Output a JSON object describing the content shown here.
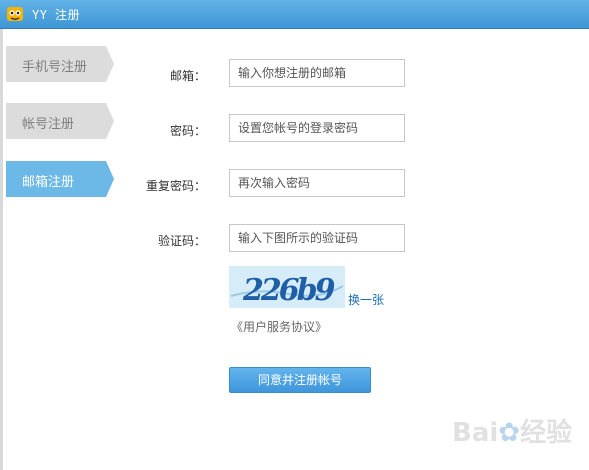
{
  "window": {
    "title": "YY 注册"
  },
  "tabs": [
    {
      "label": "手机号注册",
      "active": false
    },
    {
      "label": "帐号注册",
      "active": false
    },
    {
      "label": "邮箱注册",
      "active": true
    }
  ],
  "form": {
    "email": {
      "label": "邮箱：",
      "placeholder": "输入你想注册的邮箱"
    },
    "password": {
      "label": "密码：",
      "placeholder": "设置您帐号的登录密码"
    },
    "confirm": {
      "label": "重复密码：",
      "placeholder": "再次输入密码"
    },
    "captcha": {
      "label": "验证码：",
      "placeholder": "输入下图所示的验证码",
      "image_text": "226b9"
    },
    "refresh_label": "换一张",
    "agreement_label": "《用户服务协议》",
    "submit_label": "同意并注册帐号"
  },
  "colors": {
    "titlebar": "#3f97d6",
    "active_tab": "#6cb8e6",
    "inactive_tab": "#dcdcdc",
    "link": "#1a6fb5",
    "button": "#4a9fe0"
  }
}
